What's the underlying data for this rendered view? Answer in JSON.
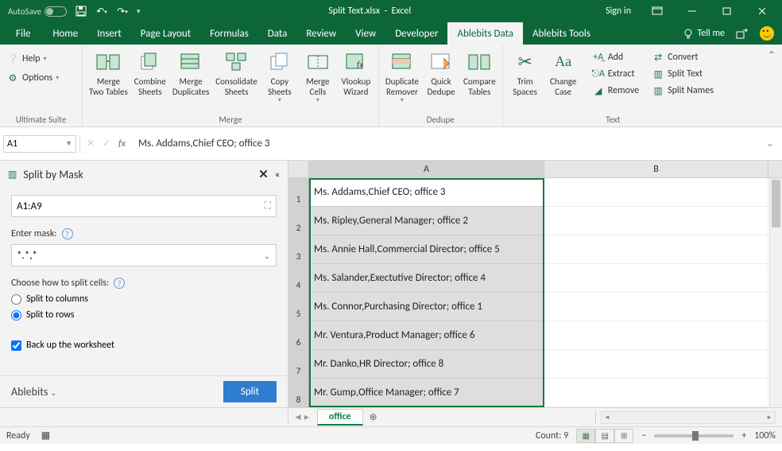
{
  "titlebar": {
    "autosave_label": "AutoSave",
    "autosave_state": "Off",
    "title_file": "Split Text.xlsx",
    "title_app": "Excel",
    "sign_in": "Sign in"
  },
  "tabs": {
    "file": "File",
    "items": [
      "Home",
      "Insert",
      "Page Layout",
      "Formulas",
      "Data",
      "Review",
      "View",
      "Developer",
      "Ablebits Data",
      "Ablebits Tools"
    ],
    "active_index": 8,
    "tellme": "Tell me"
  },
  "ribbon": {
    "suite": {
      "help": "Help",
      "options": "Options",
      "label": "Ultimate Suite"
    },
    "merge": {
      "items": [
        "Merge\nTwo Tables",
        "Combine\nSheets",
        "Merge\nDuplicates",
        "Consolidate\nSheets",
        "Copy\nSheets",
        "Merge\nCells",
        "Vlookup\nWizard"
      ],
      "label": "Merge"
    },
    "dedupe": {
      "items": [
        "Duplicate\nRemover",
        "Quick\nDedupe",
        "Compare\nTables"
      ],
      "label": "Dedupe"
    },
    "text": {
      "big": [
        "Trim\nSpaces",
        "Change\nCase"
      ],
      "small": [
        "Add",
        "Extract",
        "Remove",
        "Convert",
        "Split Text",
        "Split Names"
      ],
      "label": "Text"
    }
  },
  "formula_bar": {
    "namebox": "A1",
    "formula": "Ms. Addams,Chief CEO; office  3"
  },
  "taskpane": {
    "title": "Split by Mask",
    "range": "A1:A9",
    "mask_label": "Enter mask:",
    "mask_value": "*.*,*",
    "choose_label": "Choose how to split cells:",
    "radio_cols": "Split to columns",
    "radio_rows": "Split to rows",
    "radio_selected": "rows",
    "backup": "Back up the worksheet",
    "backup_checked": true,
    "brand": "Ablebits",
    "split_btn": "Split"
  },
  "grid": {
    "columns": [
      "A",
      "B"
    ],
    "rows": [
      {
        "n": 1,
        "a": "Ms. Addams,Chief CEO; office  3"
      },
      {
        "n": 2,
        "a": "Ms. Ripley,General Manager; office  2"
      },
      {
        "n": 3,
        "a": "Ms. Annie Hall,Commercial Director; office  5"
      },
      {
        "n": 4,
        "a": "Ms. Salander,Exectutive Director; office  4"
      },
      {
        "n": 5,
        "a": "Ms. Connor,Purchasing Director; office  1"
      },
      {
        "n": 6,
        "a": "Mr. Ventura,Product Manager; office  6"
      },
      {
        "n": 7,
        "a": "Mr. Danko,HR Director; office  8"
      },
      {
        "n": 8,
        "a": "Mr. Gump,Office Manager; office  7"
      }
    ]
  },
  "sheets": {
    "active": "office"
  },
  "statusbar": {
    "ready": "Ready",
    "count": "Count: 9",
    "zoom": "100%"
  }
}
